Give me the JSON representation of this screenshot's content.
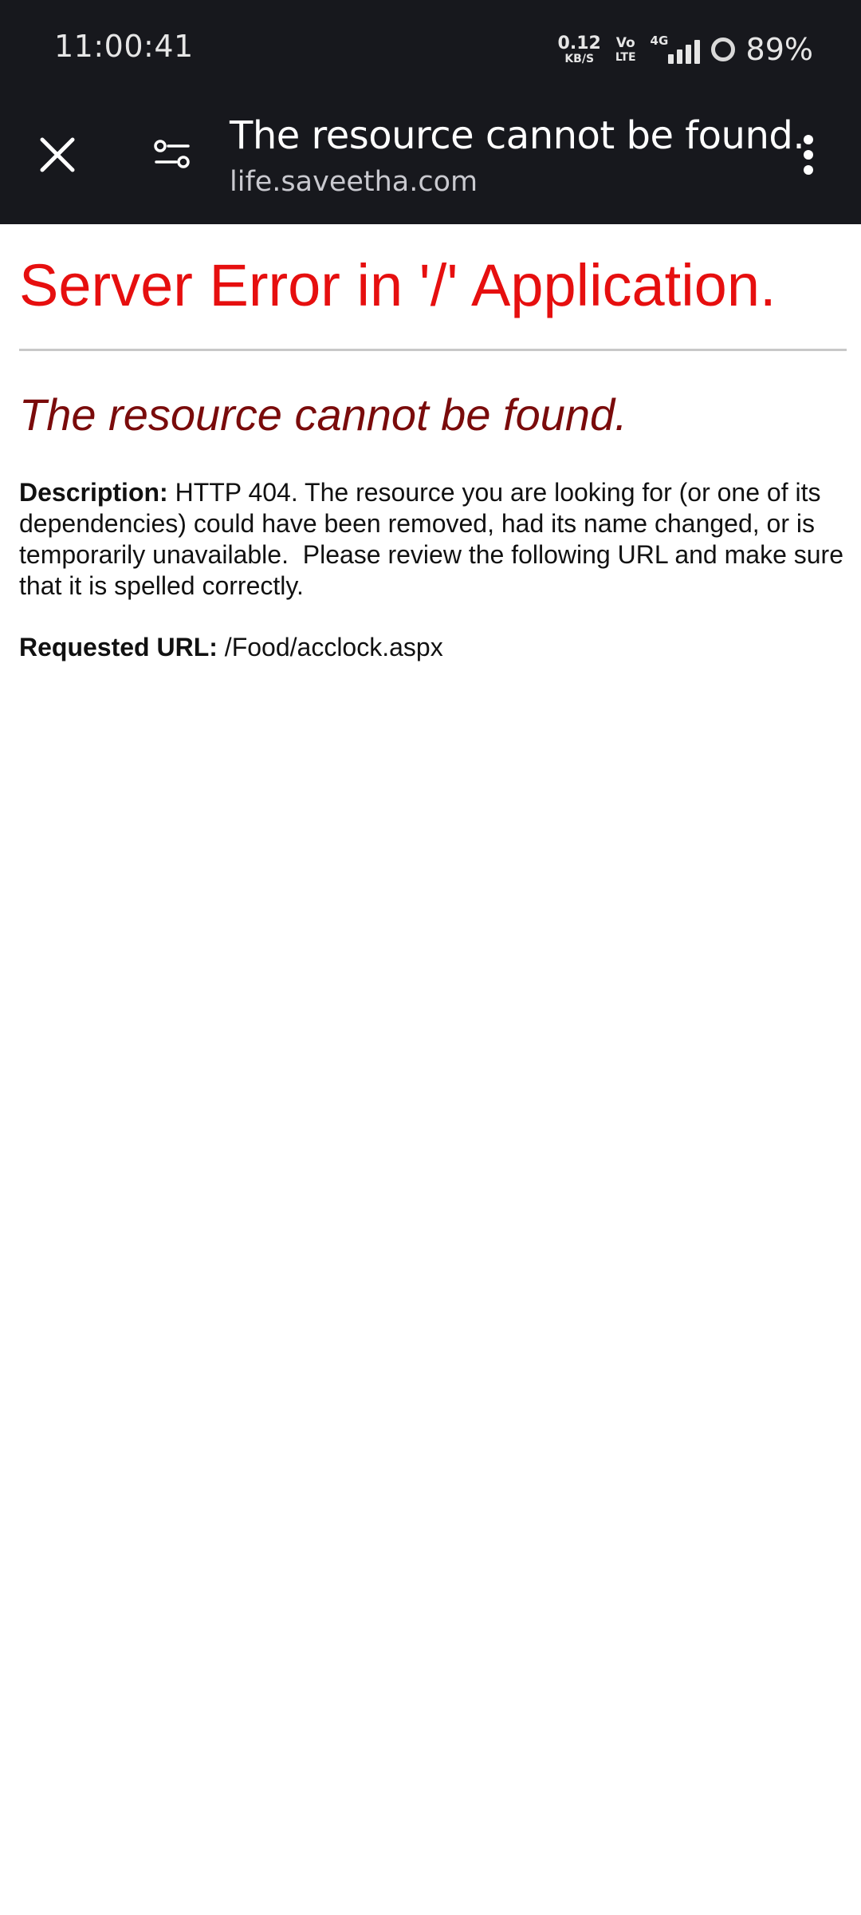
{
  "status_bar": {
    "time": "11:00:41",
    "net_speed_value": "0.12",
    "net_speed_unit": "KB/S",
    "volte_top": "Vo",
    "volte_bottom": "LTE",
    "network_type": "4G",
    "battery_percent": "89%"
  },
  "toolbar": {
    "title": "The resource cannot be found.",
    "url": "life.saveetha.com",
    "icons": [
      "close-icon",
      "page-settings-icon",
      "more-vert-icon"
    ]
  },
  "page": {
    "server_error_title": "Server Error in '/' Application.",
    "resource_heading": "The resource cannot be found.",
    "description_label": "Description:",
    "description_text": " HTTP 404. The resource you are looking for (or one of its dependencies) could have been removed, had its name changed, or is temporarily unavailable.  Please review the following URL and make sure that it is spelled correctly.",
    "requested_url_label": "Requested URL:",
    "requested_url_value": " /Food/acclock.aspx"
  },
  "colors": {
    "chrome_bg": "#17181d",
    "error_title": "#e60f0f",
    "heading": "#7a0b0b"
  }
}
